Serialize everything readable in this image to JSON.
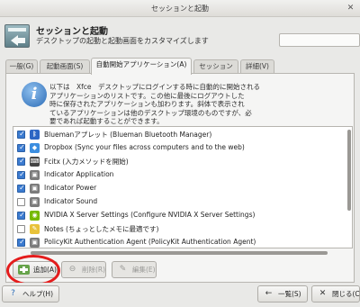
{
  "window": {
    "title": "セッションと起動",
    "close_glyph": "✕"
  },
  "header": {
    "title": "セッションと起動",
    "subtitle": "デスクトップの起動と起動画面をカスタマイズします"
  },
  "tabs": [
    {
      "label": "一般(G)"
    },
    {
      "label": "起動画面(S)"
    },
    {
      "label": "自動開始アプリケーション(A)"
    },
    {
      "label": "セッション(S)"
    },
    {
      "label": "詳細(V)"
    }
  ],
  "info": {
    "icon_glyph": "i",
    "text": "以下は　Xfce　デスクトップにログインする時に自動的に開始される\nアプリケーションのリストです。この他に最後にログアウトした\n時に保存されたアプリケーションも加わります。斜体で表示され\nているアプリケーションは他のデスクトップ環境のものですが、必\n要であれば起動することができます。"
  },
  "apps": [
    {
      "label": "Bluemanアプレット (Blueman Bluetooth Manager)",
      "checked": true,
      "icon": "bluetooth-icon",
      "glyph": "ᛒ",
      "color": "#2d66c4"
    },
    {
      "label": "Dropbox (Sync your files across computers and to the web)",
      "checked": true,
      "icon": "dropbox-icon",
      "glyph": "◆",
      "color": "#3c8ee0"
    },
    {
      "label": "Fcitx (入力メソッドを開始)",
      "checked": true,
      "icon": "keyboard-icon",
      "glyph": "⌨",
      "color": "#444444"
    },
    {
      "label": "Indicator Application",
      "checked": true,
      "icon": "indicator-icon",
      "glyph": "▣",
      "color": "#7b7b7b"
    },
    {
      "label": "Indicator Power",
      "checked": true,
      "icon": "indicator-icon",
      "glyph": "▣",
      "color": "#7b7b7b"
    },
    {
      "label": "Indicator Sound",
      "checked": false,
      "icon": "indicator-icon",
      "glyph": "▣",
      "color": "#7b7b7b"
    },
    {
      "label": "NVIDIA X Server Settings (Configure NVIDIA X Server Settings)",
      "checked": true,
      "icon": "nvidia-icon",
      "glyph": "◉",
      "color": "#76b900"
    },
    {
      "label": "Notes (ちょっとしたメモに最適です)",
      "checked": false,
      "icon": "notes-icon",
      "glyph": "✎",
      "color": "#e8c23a"
    },
    {
      "label": "PolicyKit Authentication Agent (PolicyKit Authentication Agent)",
      "checked": true,
      "icon": "policykit-icon",
      "glyph": "▣",
      "color": "#7b7b7b"
    }
  ],
  "buttons": {
    "add": "追加(A)",
    "remove": "削除(R)",
    "edit": "編集(E)",
    "help": "ヘルプ(H)",
    "overview": "一覧(S)",
    "close": "閉じる(C)",
    "remove_glyph": "⊖",
    "edit_glyph": "✎",
    "help_glyph": "?",
    "overview_glyph": "←",
    "close_glyph": "✕"
  },
  "colors": {
    "highlight_ring": "#e41c1c",
    "checkbox_checked": "#3b7bd0",
    "info_icon": "#2b6bb6"
  }
}
